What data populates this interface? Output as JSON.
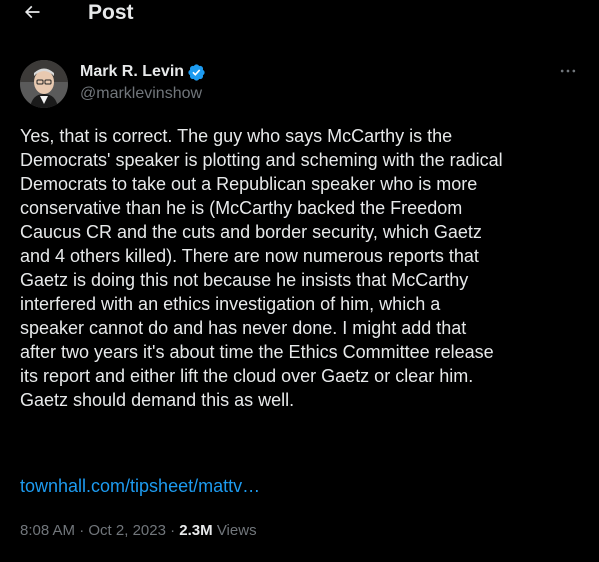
{
  "topbar": {
    "title": "Post"
  },
  "author": {
    "name": "Mark R. Levin",
    "handle": "@marklevinshow"
  },
  "post": {
    "text": "Yes, that is correct.  The guy who says McCarthy is the\nDemocrats' speaker is plotting and scheming with the radical\nDemocrats to take out a Republican speaker who is more\nconservative than he is (McCarthy backed the Freedom\nCaucus CR and the cuts and border security, which Gaetz\nand 4 others killed).  There are now numerous reports that\nGaetz is doing this not because he insists that McCarthy\ninterfered with an ethics investigation of him, which a\nspeaker cannot do and has never done.  I might add that\nafter two years it's about time the Ethics Committee release\nits report and either lift the cloud over Gaetz or clear him.\nGaetz should demand this as well.",
    "link": "townhall.com/tipsheet/mattv…"
  },
  "meta": {
    "time": "8:08 AM",
    "dot1": " · ",
    "date": "Oct 2, 2023",
    "dot2": " · ",
    "views_count": "2.3M",
    "views_label": " Views"
  },
  "colors": {
    "background": "#000000",
    "text_primary": "#e7e9ea",
    "text_secondary": "#71767b",
    "link": "#1d9bf0",
    "verified": "#1d9bf0"
  },
  "icons": {
    "back": "arrow-left-icon",
    "verified": "verified-badge-icon",
    "more": "more-horizontal-icon"
  }
}
